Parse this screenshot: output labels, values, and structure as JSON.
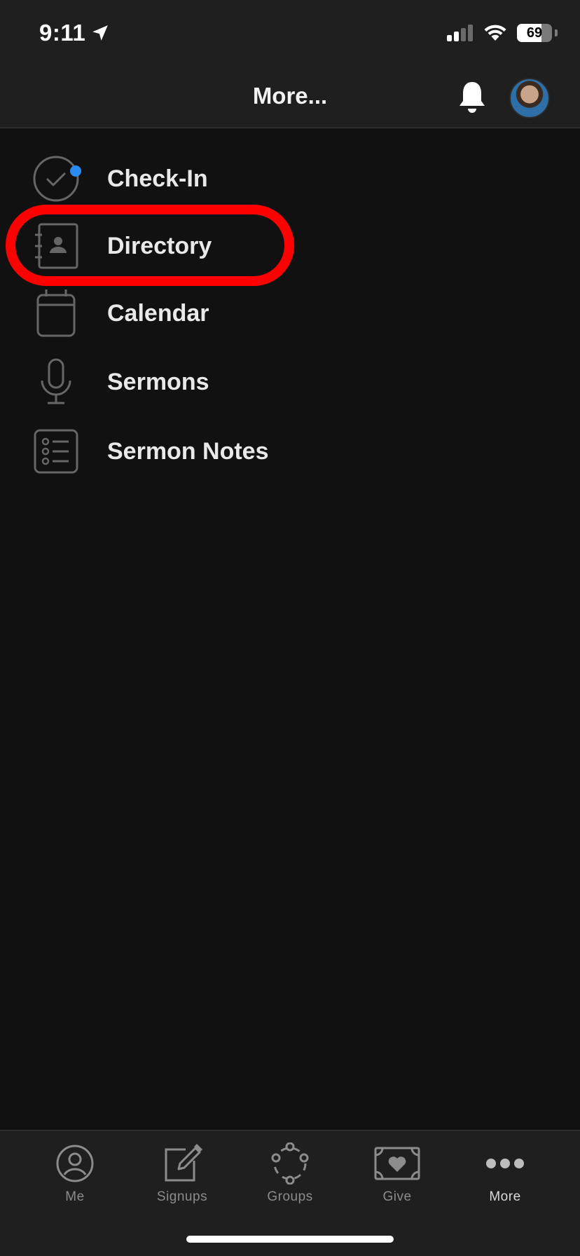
{
  "status_bar": {
    "time": "9:11",
    "battery": "69",
    "battery_level_percent": 69,
    "icons": [
      "location-arrow-icon",
      "signal-icon",
      "wifi-icon",
      "battery-icon"
    ]
  },
  "header": {
    "title": "More...",
    "icons": [
      "bell-icon",
      "avatar"
    ]
  },
  "menu": {
    "items": [
      {
        "label": "Check-In",
        "icon": "check-circle-icon",
        "badge": true
      },
      {
        "label": "Directory",
        "icon": "address-book-icon",
        "highlighted": true
      },
      {
        "label": "Calendar",
        "icon": "calendar-icon"
      },
      {
        "label": "Sermons",
        "icon": "microphone-icon"
      },
      {
        "label": "Sermon Notes",
        "icon": "list-notes-icon"
      }
    ]
  },
  "tabbar": {
    "tabs": [
      {
        "label": "Me",
        "icon": "person-circle-icon"
      },
      {
        "label": "Signups",
        "icon": "edit-form-icon"
      },
      {
        "label": "Groups",
        "icon": "groups-icon"
      },
      {
        "label": "Give",
        "icon": "money-heart-icon"
      },
      {
        "label": "More",
        "icon": "more-dots-icon",
        "active": true
      }
    ]
  },
  "colors": {
    "background": "#111111",
    "bar_background": "#1f1f1f",
    "highlight": "#ff0000",
    "badge": "#2a8cf0"
  }
}
